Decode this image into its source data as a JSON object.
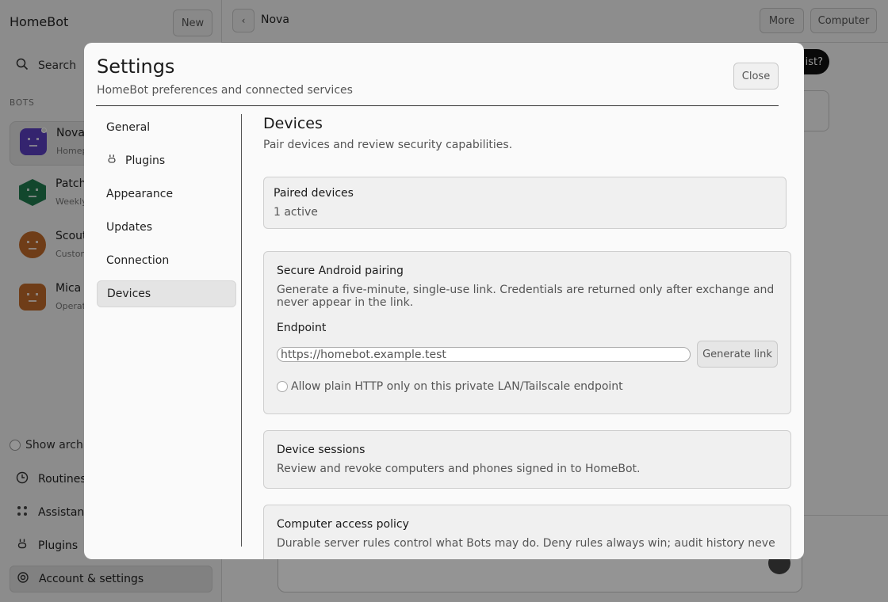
{
  "app": {
    "brand": "HomeBot",
    "new_label": "New",
    "search_label": "Search",
    "bots_section": "BOTS",
    "bots": [
      {
        "name": "Nova",
        "sub": "Homep",
        "color": "#5a3fc0",
        "shape": "square",
        "active": true
      },
      {
        "name": "Patch",
        "sub": "Weekly",
        "color": "#1f7a4f",
        "shape": "hexagon",
        "active": false
      },
      {
        "name": "Scout",
        "sub": "Custom",
        "color": "#c06a2a",
        "shape": "circle",
        "active": false
      },
      {
        "name": "Mica",
        "sub": "Operat",
        "color": "#c06a2a",
        "shape": "square",
        "active": false
      }
    ],
    "show_archived_label": "Show archiv",
    "nav": [
      {
        "label": "Routines",
        "icon": "clock-icon"
      },
      {
        "label": "Assistant",
        "icon": "grid-icon"
      },
      {
        "label": "Plugins",
        "icon": "plug-icon"
      },
      {
        "label": "Account & settings",
        "icon": "gear-icon"
      }
    ],
    "chat_title": "Nova",
    "more_label": "More",
    "computer_label": "Computer",
    "pill_text": "ist?"
  },
  "modal": {
    "title": "Settings",
    "subtitle": "HomeBot preferences and connected services",
    "close_label": "Close",
    "tabs": [
      {
        "label": "General",
        "icon": null
      },
      {
        "label": "Plugins",
        "icon": "plug-icon"
      },
      {
        "label": "Appearance",
        "icon": null
      },
      {
        "label": "Updates",
        "icon": null
      },
      {
        "label": "Connection",
        "icon": null
      },
      {
        "label": "Devices",
        "icon": null,
        "selected": true
      }
    ],
    "pane": {
      "title": "Devices",
      "subtitle": "Pair devices and review security capabilities.",
      "paired": {
        "title": "Paired devices",
        "status": "1 active"
      },
      "android": {
        "title": "Secure Android pairing",
        "desc": "Generate a five-minute, single-use link. Credentials are returned only after exchange and never appear in the link.",
        "endpoint_label": "Endpoint",
        "endpoint_value": "https://homebot.example.test",
        "generate_label": "Generate link",
        "http_label": "Allow plain HTTP only on this private LAN/Tailscale endpoint"
      },
      "sessions": {
        "title": "Device sessions",
        "desc": "Review and revoke computers and phones signed in to HomeBot."
      },
      "policy": {
        "title": "Computer access policy",
        "desc": "Durable server rules control what Bots may do. Deny rules always win; audit history never contains"
      }
    }
  }
}
